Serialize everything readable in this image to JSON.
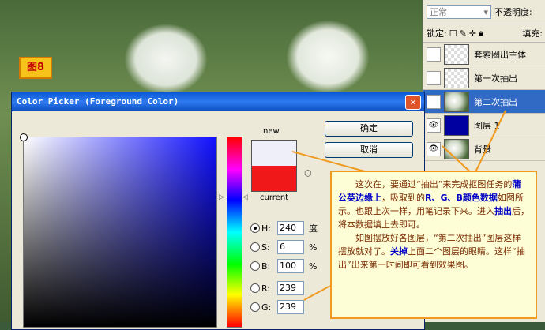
{
  "figure_label": "图8",
  "layers_panel": {
    "blend_mode": "正常",
    "opacity_label": "不透明度:",
    "lock_label": "锁定:",
    "fill_label": "填充:",
    "layers": [
      {
        "name": "套索圈出主体",
        "visible": false,
        "selected": false,
        "thumb": "checker"
      },
      {
        "name": "第一次抽出",
        "visible": false,
        "selected": false,
        "thumb": "checker"
      },
      {
        "name": "第二次抽出",
        "visible": true,
        "selected": true,
        "thumb": "flower"
      },
      {
        "name": "图层 1",
        "visible": true,
        "selected": false,
        "thumb": "blue"
      },
      {
        "name": "背景",
        "visible": true,
        "selected": false,
        "thumb": "flower"
      }
    ]
  },
  "color_picker": {
    "title": "Color Picker (Foreground Color)",
    "new_label": "new",
    "current_label": "current",
    "new_color": "#efeffa",
    "current_color": "#f01818",
    "ok_button": "确定",
    "cancel_button": "取消",
    "fields": [
      {
        "label": "H:",
        "value": "240",
        "unit": "度",
        "selected": true
      },
      {
        "label": "S:",
        "value": "6",
        "unit": "%",
        "selected": false
      },
      {
        "label": "B:",
        "value": "100",
        "unit": "%",
        "selected": false
      },
      {
        "label": "R:",
        "value": "239",
        "unit": "",
        "selected": false
      },
      {
        "label": "G:",
        "value": "239",
        "unit": "",
        "selected": false
      }
    ]
  },
  "callout": {
    "p1_a": "这次在，要通过“抽出”来完成抠图任务的",
    "p1_b": "蒲公英边缘上",
    "p1_c": "，吸取到的",
    "p1_d": "R、G、B颜色数据",
    "p1_e": "如图所示。也跟上次一样，用笔记录下来。进入",
    "p1_f": "抽出",
    "p1_g": "后，将本数据填上去即可。",
    "p2_a": "如图摆放好各图层，“第二次抽出”图层这样摆放就对了。",
    "p2_b": "关掉",
    "p2_c": "上面二个图层的眼睛。这样“抽出”出来第一时间即可看到效果图。"
  },
  "accent_color": "#f09a20"
}
